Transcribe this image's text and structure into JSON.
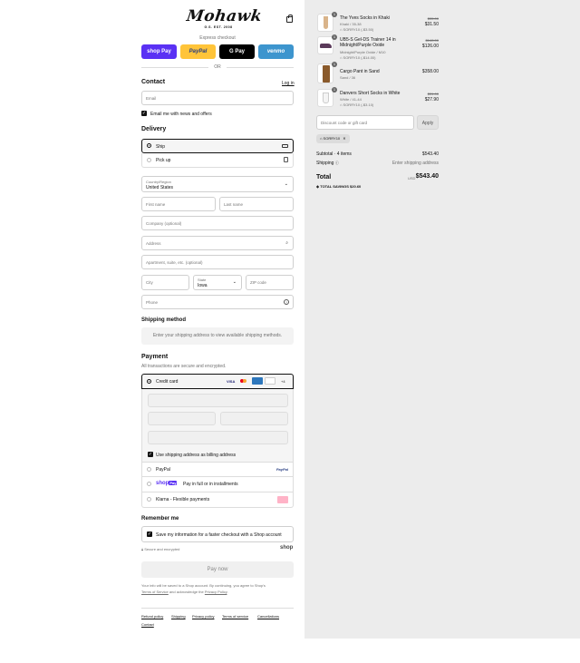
{
  "brand": {
    "logo": "Mohawk",
    "tagline": "G.S. EST. 2008"
  },
  "express": {
    "title": "Express checkout",
    "buttons": [
      "shop Pay",
      "PayPal",
      "G Pay",
      "venmo"
    ],
    "or": "OR"
  },
  "contact": {
    "title": "Contact",
    "login": "Log in",
    "email_placeholder": "Email",
    "newsletter": "Email me with news and offers"
  },
  "delivery": {
    "title": "Delivery",
    "ship": "Ship",
    "pickup": "Pick up",
    "country_label": "Country/Region",
    "country_value": "United States",
    "first_name": "First name",
    "last_name": "Last name",
    "company": "Company (optional)",
    "address": "Address",
    "apartment": "Apartment, suite, etc. (optional)",
    "city": "City",
    "state_label": "State",
    "state_value": "Iowa",
    "zip": "ZIP code",
    "phone": "Phone"
  },
  "shipping_method": {
    "title": "Shipping method",
    "notice": "Enter your shipping address to view available shipping methods."
  },
  "payment": {
    "title": "Payment",
    "subtitle": "All transactions are secure and encrypted.",
    "credit_card": "Credit card",
    "more_cards": "+4",
    "billing_same": "Use shipping address as billing address",
    "paypal": "PayPal",
    "shoppay_text": "Pay in full or in installments",
    "klarna": "Klarna - Flexible payments"
  },
  "remember": {
    "title": "Remember me",
    "save": "Save my information for a faster checkout with a Shop account",
    "secure": "Secure and encrypted",
    "shop": "shop"
  },
  "pay_now": "Pay now",
  "legal": {
    "line1": "Your info will be saved to a Shop account. By continuing, you agree to Shop's",
    "terms": "Terms of Service",
    "and_ack": "and acknowledge the",
    "privacy": "Privacy Policy",
    "dot": "."
  },
  "footer_links": [
    "Refund policy",
    "Shipping",
    "Privacy policy",
    "Terms of service",
    "Cancellations",
    "Contact"
  ],
  "cart": {
    "items": [
      {
        "qty": "1",
        "name": "The Yves Socks in Khaki",
        "variant": "Khaki / 35-38",
        "discount": "SORRY10 (-$3.50)",
        "old_price": "$35.00",
        "price": "$31.50"
      },
      {
        "qty": "1",
        "name": "UB5-S Gel-DS Trainer 14 in Midnight/Purple Oxide",
        "variant": "Midnight/Purple Oxide / M10",
        "discount": "SORRY10 (-$14.00)",
        "old_price": "$140.00",
        "price": "$126.00"
      },
      {
        "qty": "1",
        "name": "Cargo Pant in Sand",
        "variant": "Sand / 36",
        "discount": "",
        "old_price": "",
        "price": "$358.00"
      },
      {
        "qty": "1",
        "name": "Danvers Short Socks in White",
        "variant": "White / 41-44",
        "discount": "SORRY10 (-$3.10)",
        "old_price": "$31.00",
        "price": "$27.90"
      }
    ],
    "discount_placeholder": "Discount code or gift card",
    "apply": "Apply",
    "code_tag": "SORRY10",
    "subtotal_label": "Subtotal · 4 items",
    "subtotal_value": "$543.40",
    "shipping_label": "Shipping",
    "shipping_value": "Enter shipping address",
    "total_label": "Total",
    "currency": "USD",
    "total_value": "$543.40",
    "savings_label": "TOTAL SAVINGS",
    "savings_value": "$20.60"
  },
  "colors": {
    "shoppay": "#5a31f4",
    "paypal": "#ffc439",
    "gpay": "#000000",
    "venmo": "#3d95ce",
    "right_bg": "#ececec"
  }
}
